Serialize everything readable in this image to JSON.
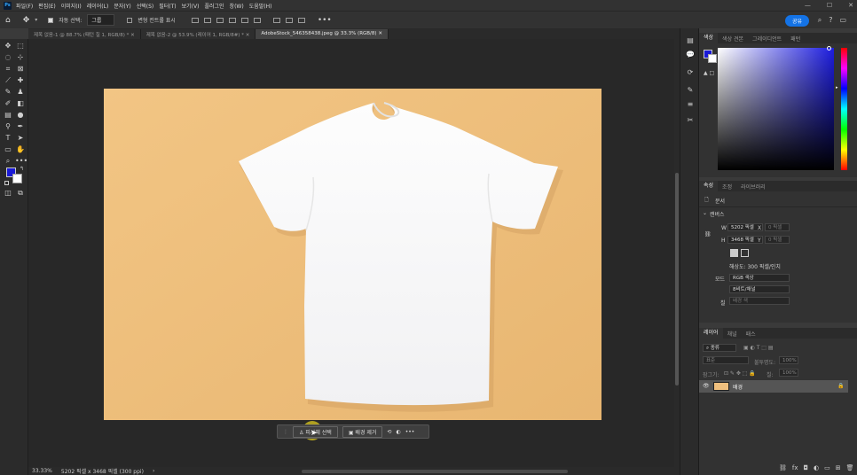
{
  "app": {
    "logo": "Ps"
  },
  "menu": [
    "파일(F)",
    "편집(E)",
    "이미지(I)",
    "레이어(L)",
    "문자(Y)",
    "선택(S)",
    "필터(T)",
    "보기(V)",
    "플러그인",
    "창(W)",
    "도움말(H)"
  ],
  "window_controls": [
    "—",
    "☐",
    "✕"
  ],
  "options": {
    "auto_select_label": "자동 선택:",
    "auto_select_value": "그룹",
    "transform_label": "변형 컨트롤 표시",
    "share_label": "공유"
  },
  "tabs": [
    {
      "label": "제목 없음-1 @ 88.7% (패턴 칠 1, RGB/8) *"
    },
    {
      "label": "제목 없음-2 @ 53.9% (레이어 1, RGB/8#) *"
    },
    {
      "label": "AdobeStock_546358438.jpeg @ 33.3% (RGB/8)"
    }
  ],
  "context_bar": {
    "select_subject": "피사체 선택",
    "remove_bg": "배경 제거"
  },
  "status": {
    "zoom": "33.33%",
    "doc_info": "5202 픽셀 x 3468 픽셀 (300 ppi)"
  },
  "color_panel": {
    "tabs": [
      "색상",
      "색상 견본",
      "그레이디언트",
      "패턴"
    ],
    "fg_color": "#1a1ad6",
    "bg_color": "#ffffff"
  },
  "properties": {
    "tabs": [
      "속성",
      "조정",
      "라이브러리"
    ],
    "doc_label": "문서",
    "canvas_label": "캔버스",
    "w_label": "W",
    "w_value": "5202 픽셀",
    "h_label": "H",
    "h_value": "3468 픽셀",
    "x_label": "X",
    "x_value": "0 픽셀",
    "y_label": "Y",
    "y_value": "0 픽셀",
    "resolution": "해상도: 300 픽셀/인치",
    "mode_label": "모드",
    "mode_value": "RGB 색상",
    "depth_value": "8비트/채널",
    "fill_label": "칠",
    "fill_value": "배경 색"
  },
  "layers_panel": {
    "tabs": [
      "레이어",
      "채널",
      "패스"
    ],
    "filter_placeholder": "종류",
    "blend_mode": "표준",
    "opacity_label": "불투명도:",
    "opacity_value": "100%",
    "lock_label": "잠그기:",
    "fill_label": "칠:",
    "fill_value": "100%",
    "layers": [
      {
        "name": "배경"
      }
    ]
  }
}
